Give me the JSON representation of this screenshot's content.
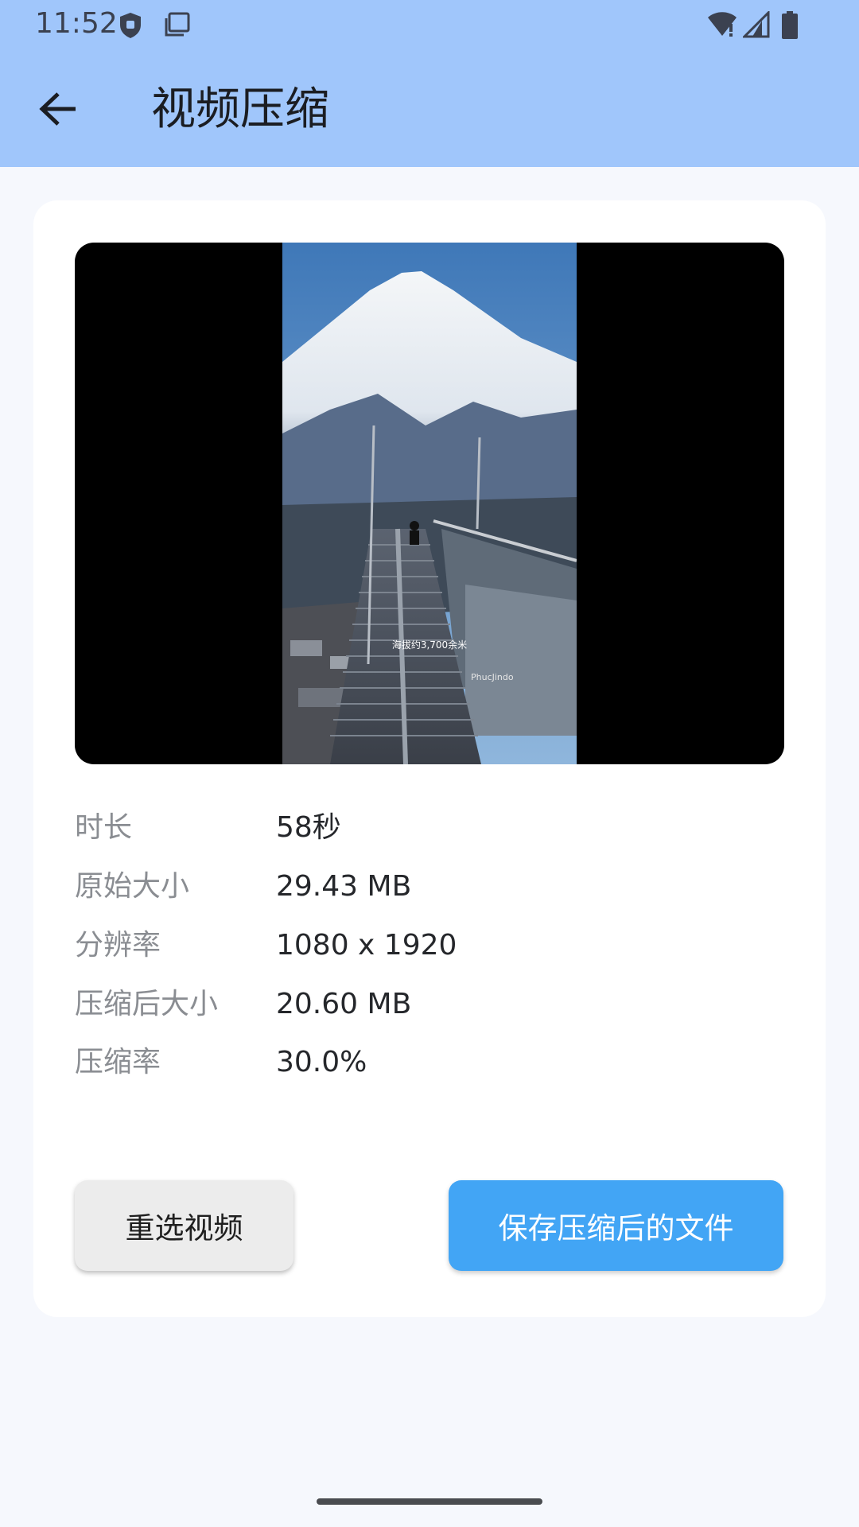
{
  "status_bar": {
    "time": "11:52",
    "left_icons": [
      "shield-icon",
      "screenshot-icon"
    ],
    "right_icons": [
      "wifi-icon",
      "signal-icon",
      "battery-icon"
    ]
  },
  "app_bar": {
    "title": "视频压缩",
    "back_icon": "arrow-back-icon"
  },
  "video": {
    "overlay_caption": "海拔约3,700余米",
    "watermark": "PhucJindo"
  },
  "info": [
    {
      "label": "时长",
      "value": "58秒"
    },
    {
      "label": "原始大小",
      "value": "29.43 MB"
    },
    {
      "label": "分辨率",
      "value": "1080 x 1920"
    },
    {
      "label": "压缩后大小",
      "value": "20.60 MB"
    },
    {
      "label": "压缩率",
      "value": "30.0%"
    }
  ],
  "actions": {
    "reselect_label": "重选视频",
    "save_label": "保存压缩后的文件"
  },
  "colors": {
    "app_bar": "#a0c6fb",
    "primary_button": "#42a5f5",
    "secondary_button": "#ececec",
    "background": "#f6f8fd"
  }
}
